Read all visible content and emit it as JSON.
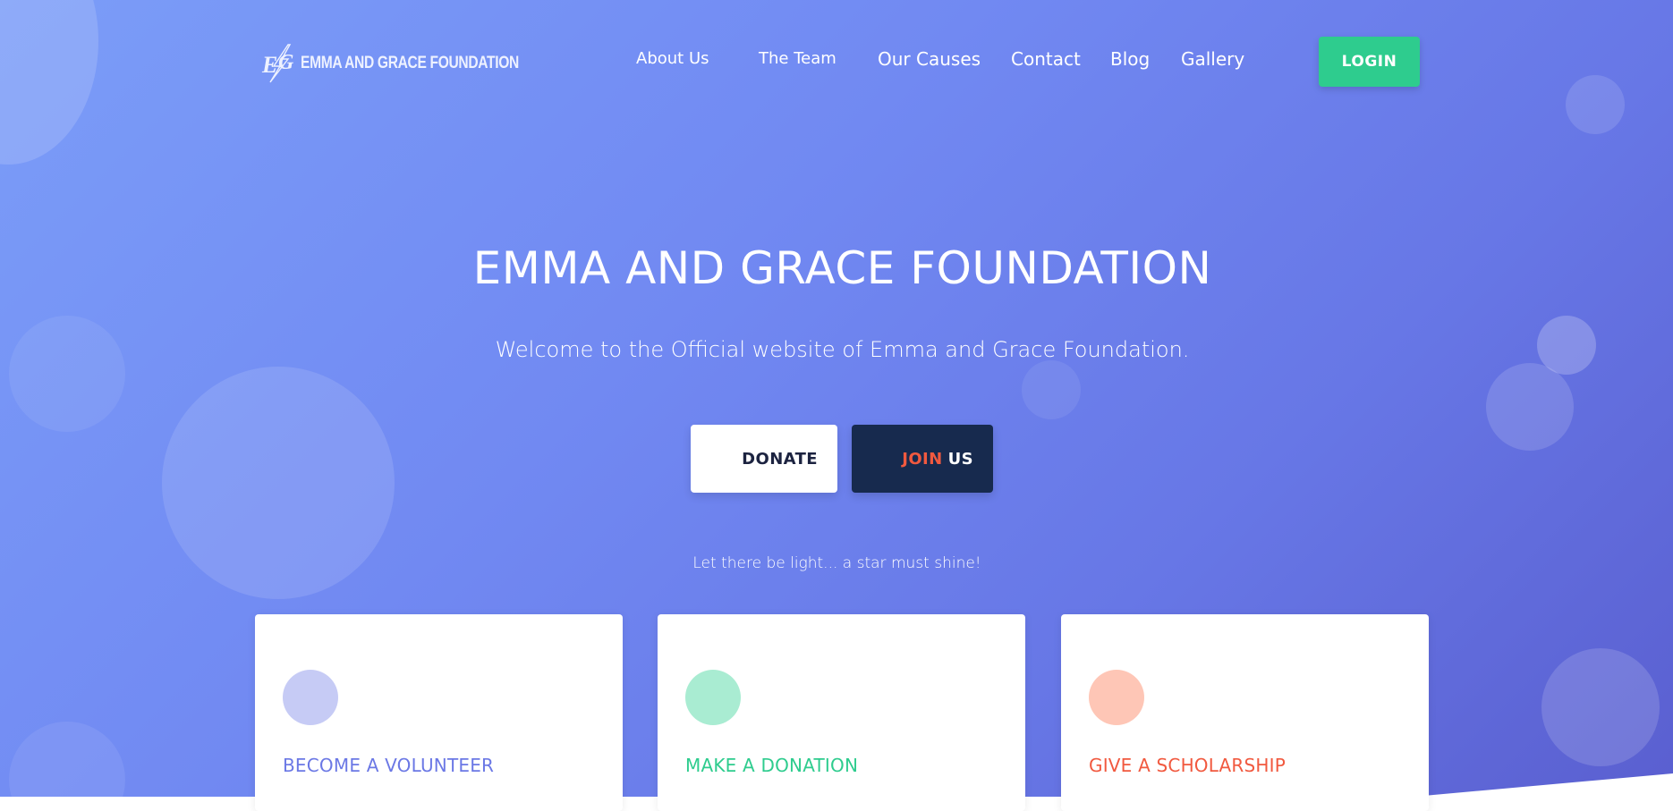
{
  "brand": {
    "logo_mark": "E G",
    "name": "EMMA AND GRACE FOUNDATION"
  },
  "nav": {
    "items": [
      {
        "label": "About Us"
      },
      {
        "label": "The Team"
      },
      {
        "label": "Our Causes"
      },
      {
        "label": "Contact"
      },
      {
        "label": "Blog"
      },
      {
        "label": "Gallery"
      }
    ],
    "login_label": "LOGIN"
  },
  "hero": {
    "title": "EMMA AND GRACE FOUNDATION",
    "subtitle": "Welcome to the Official website of Emma and Grace Foundation.",
    "donate_label": "DONATE",
    "join_label_accent": "JOIN",
    "join_label_rest": "US",
    "tagline": "Let there be light... a star must shine!"
  },
  "cards": [
    {
      "title": "BECOME A VOLUNTEER",
      "color": "#6b78e5",
      "dot_color": "#c6cbf5"
    },
    {
      "title": "MAKE A DONATION",
      "color": "#2ecc8e",
      "dot_color": "#a9ecd2"
    },
    {
      "title": "GIVE A SCHOLARSHIP",
      "color": "#f1593f",
      "dot_color": "#fec6b6"
    }
  ],
  "colors": {
    "gradient_start": "#7b9df8",
    "gradient_end": "#5a5fd0",
    "accent_green": "#2ecc8e",
    "accent_orange": "#f1593f",
    "navy": "#172a4e"
  },
  "icons": {
    "logo": "eg-lightning-logo-icon"
  }
}
